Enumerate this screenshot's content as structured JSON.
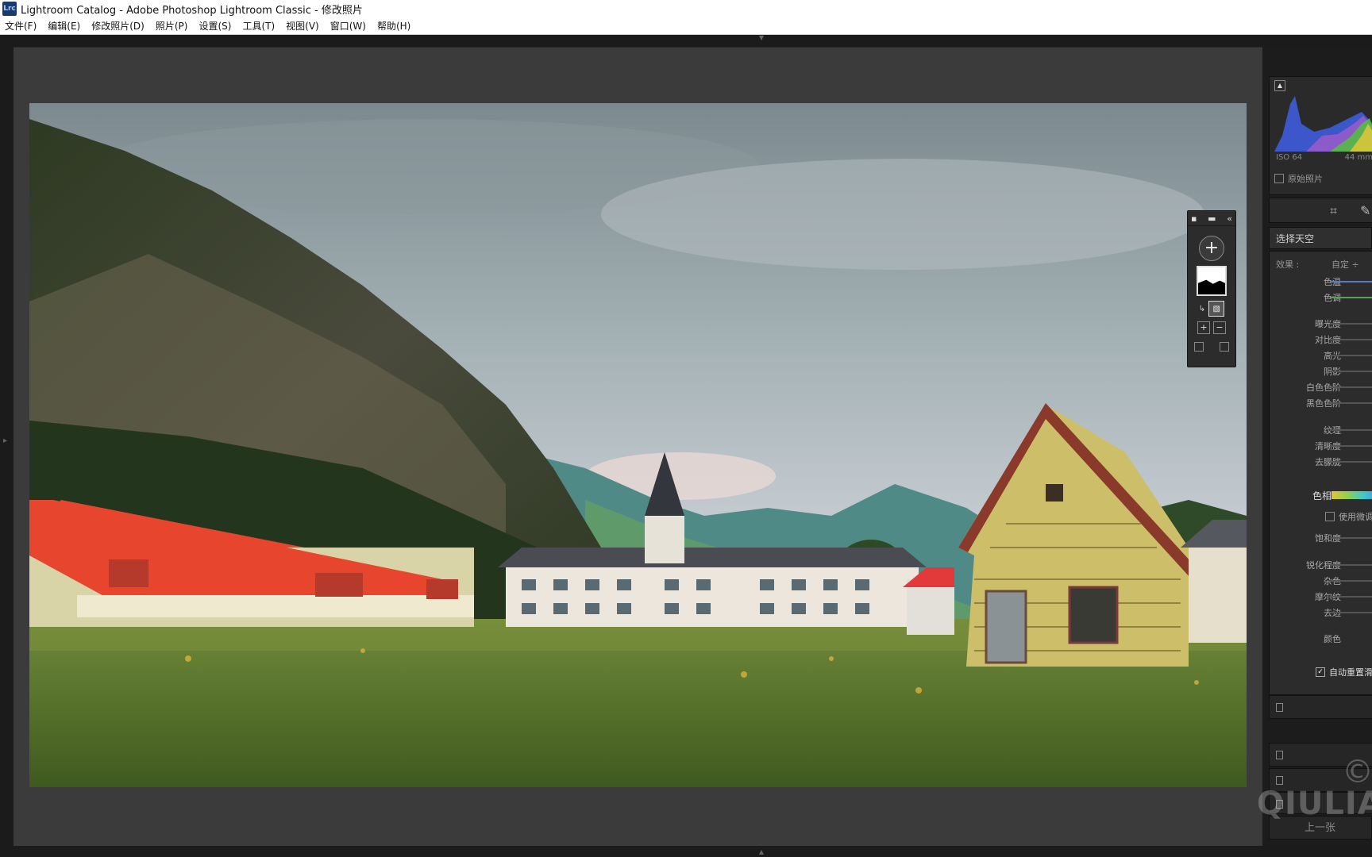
{
  "window": {
    "app_icon": "Lrc",
    "title": "Lightroom Catalog - Adobe Photoshop Lightroom Classic - 修改照片"
  },
  "menu": [
    "文件(F)",
    "编辑(E)",
    "修改照片(D)",
    "照片(P)",
    "设置(S)",
    "工具(T)",
    "视图(V)",
    "窗口(W)",
    "帮助(H)"
  ],
  "histogram": {
    "iso": "ISO 64",
    "focal": "44 mm",
    "original_photo": "原始照片"
  },
  "mask": {
    "title": "选择天空"
  },
  "adjust": {
    "effect_label": "效果 :",
    "effect_value": "自定 ÷",
    "temp": "色温",
    "tint": "色调",
    "exposure": "曝光度",
    "contrast": "对比度",
    "highlights": "高光",
    "shadows": "阴影",
    "whites": "白色色阶",
    "blacks": "黑色色阶",
    "texture": "纹理",
    "clarity": "清晰度",
    "dehaze": "去朦胧",
    "hue": "色相",
    "fine_adjust": "使用微调",
    "saturation": "饱和度",
    "sharpness": "锐化程度",
    "noise": "杂色",
    "moire": "摩尔纹",
    "defringe": "去边",
    "color": "颜色",
    "auto_reset": "自动重置滑块"
  },
  "nav": {
    "previous": "上一张"
  },
  "watermark": {
    "text": "QIULIAN",
    "symbol": "©"
  },
  "colors": {
    "workspace": "#3b3b3b",
    "panel": "#2c2c2c",
    "roof_red": "#e8452f",
    "house_yellow": "#cdbf6a"
  }
}
